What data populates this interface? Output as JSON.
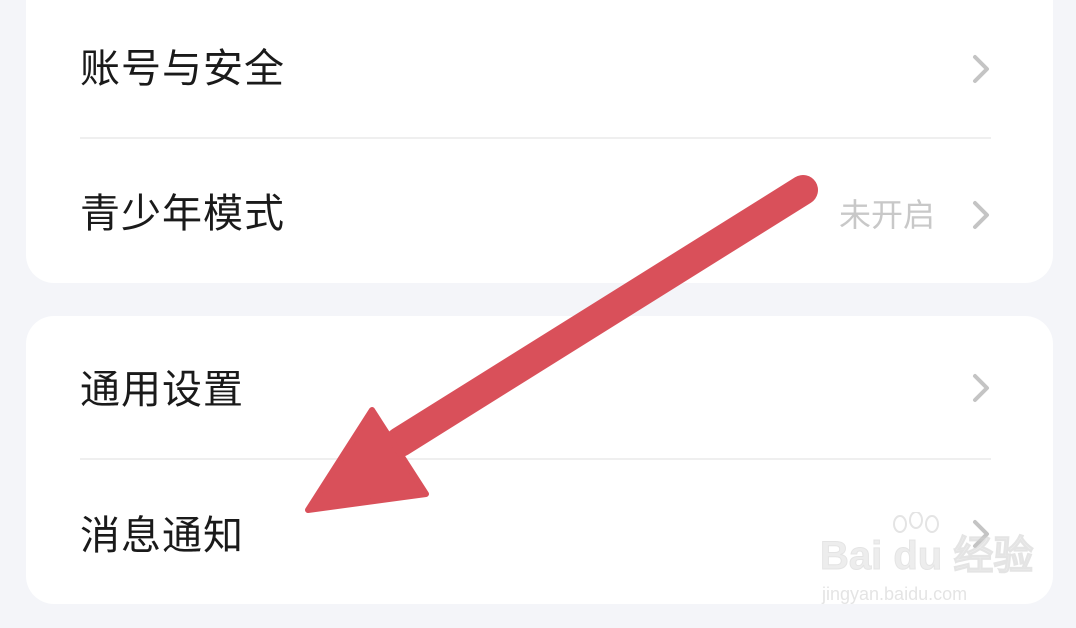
{
  "settings_group_1": {
    "items": [
      {
        "label": "账号与安全",
        "value": ""
      },
      {
        "label": "青少年模式",
        "value": "未开启"
      }
    ]
  },
  "settings_group_2": {
    "items": [
      {
        "label": "通用设置",
        "value": ""
      },
      {
        "label": "消息通知",
        "value": ""
      }
    ]
  },
  "annotation": {
    "arrow_color": "#d9505a",
    "target": "消息通知"
  },
  "watermark": {
    "logo_text": "Bai du 经验",
    "url_text": "jingyan.baidu.com"
  },
  "colors": {
    "background": "#f4f5f9",
    "card": "#ffffff",
    "label": "#1a1a1a",
    "value": "#c8c8c8",
    "chevron": "#c4c4c4"
  }
}
